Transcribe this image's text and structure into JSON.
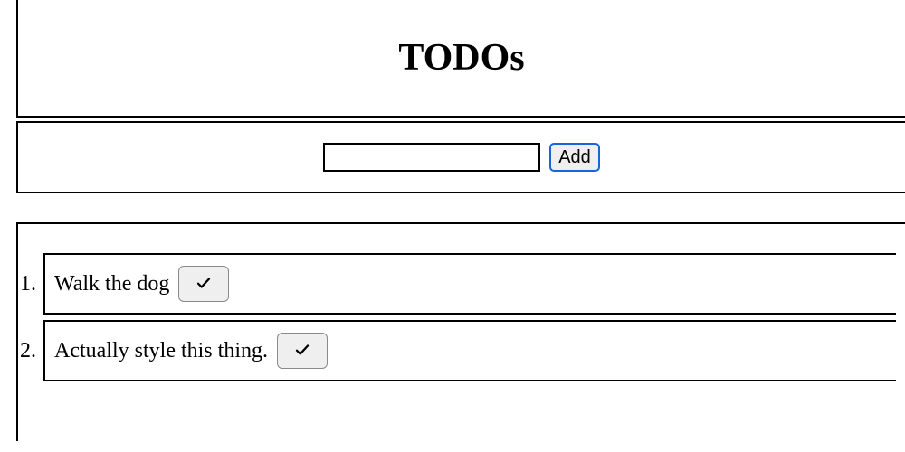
{
  "header": {
    "title": "TODOs"
  },
  "form": {
    "input_value": "",
    "add_label": "Add"
  },
  "todos": [
    {
      "number": "1.",
      "text": "Walk the dog"
    },
    {
      "number": "2.",
      "text": "Actually style this thing."
    }
  ]
}
